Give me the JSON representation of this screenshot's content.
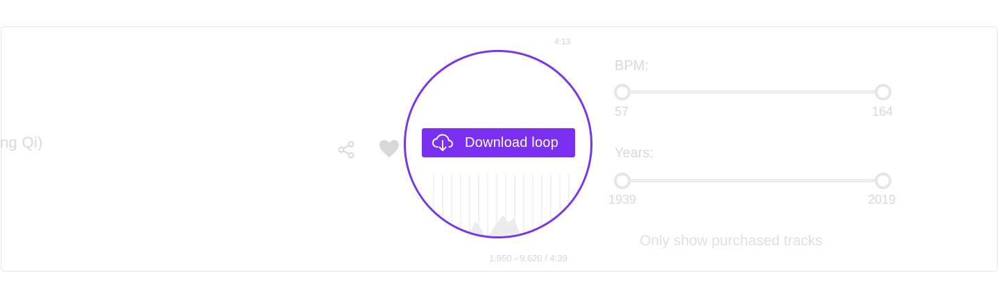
{
  "track": {
    "title_fragment": "ng Qi)",
    "time_total": "4:13",
    "loop_range": "1.950 - 9.620 / 4:39"
  },
  "actions": {
    "share_icon": "share-icon",
    "favorite_icon": "heart-icon",
    "download_label": "Download loop",
    "download_icon": "cloud-download-icon"
  },
  "filters": {
    "bpm": {
      "label": "BPM:",
      "min": "57",
      "max": "164"
    },
    "years": {
      "label": "Years:",
      "min": "1939",
      "max": "2019"
    },
    "purchased_label": "Only show purchased tracks"
  },
  "colors": {
    "accent": "#7b2ff0",
    "magnifier_ring": "#7b34ee"
  }
}
